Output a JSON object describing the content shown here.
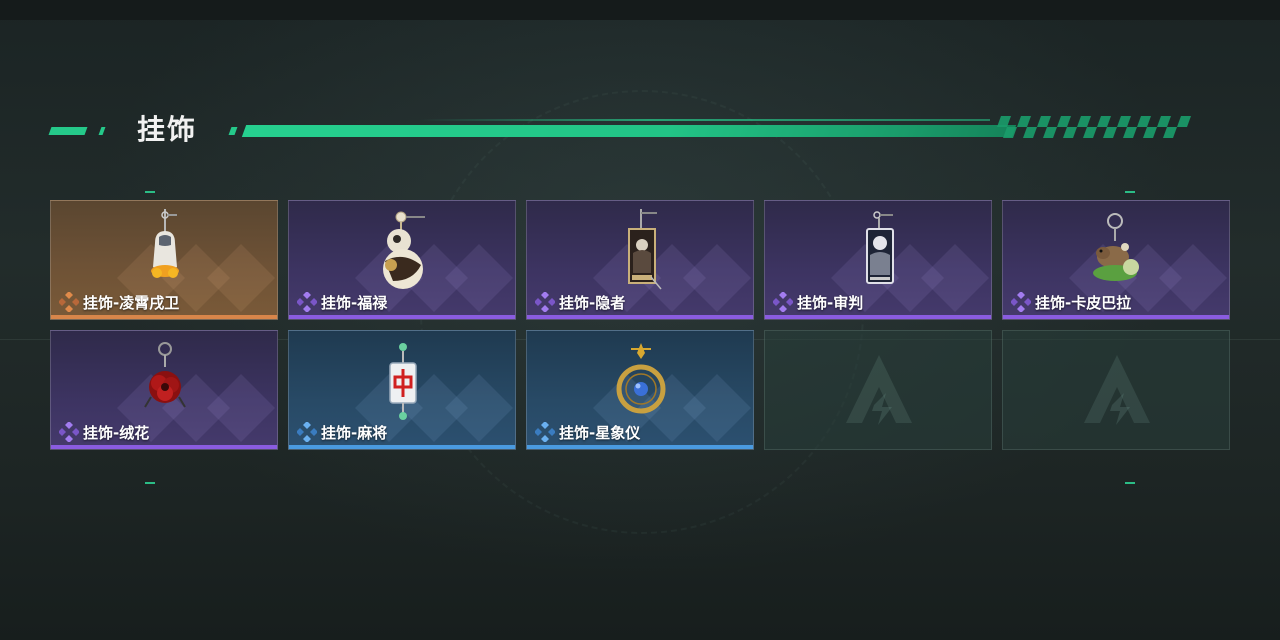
{
  "header": {
    "title": "挂饰"
  },
  "colors": {
    "accent": "#26d08f"
  },
  "items": [
    {
      "label": "挂饰-凌霄戌卫",
      "rarity": "orange",
      "art": "dog-charm-icon"
    },
    {
      "label": "挂饰-福禄",
      "rarity": "purple",
      "art": "gourd-charm-icon"
    },
    {
      "label": "挂饰-隐者",
      "rarity": "purple",
      "art": "hermit-card-charm-icon"
    },
    {
      "label": "挂饰-审判",
      "rarity": "purple",
      "art": "judgement-card-charm-icon"
    },
    {
      "label": "挂饰-卡皮巴拉",
      "rarity": "purple",
      "art": "capybara-charm-icon"
    },
    {
      "label": "挂饰-绒花",
      "rarity": "purple",
      "art": "velvet-flower-charm-icon"
    },
    {
      "label": "挂饰-麻将",
      "rarity": "blue",
      "art": "mahjong-tile-charm-icon"
    },
    {
      "label": "挂饰-星象仪",
      "rarity": "blue",
      "art": "astrolabe-charm-icon"
    },
    {
      "label": "",
      "rarity": "empty",
      "art": "empty-slot-logo-icon"
    },
    {
      "label": "",
      "rarity": "empty",
      "art": "empty-slot-logo-icon"
    }
  ]
}
